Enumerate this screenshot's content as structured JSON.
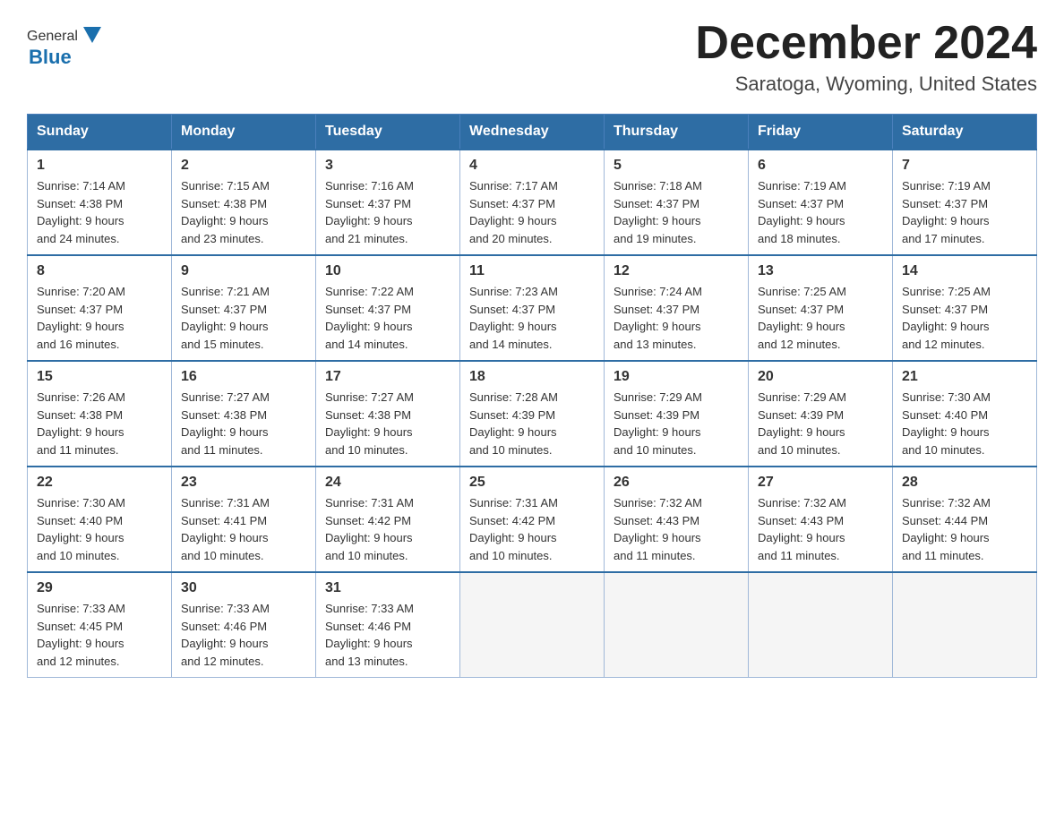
{
  "logo": {
    "general": "General",
    "blue": "Blue"
  },
  "title": "December 2024",
  "location": "Saratoga, Wyoming, United States",
  "days_of_week": [
    "Sunday",
    "Monday",
    "Tuesday",
    "Wednesday",
    "Thursday",
    "Friday",
    "Saturday"
  ],
  "weeks": [
    [
      {
        "day": "1",
        "sunrise": "7:14 AM",
        "sunset": "4:38 PM",
        "daylight": "9 hours and 24 minutes."
      },
      {
        "day": "2",
        "sunrise": "7:15 AM",
        "sunset": "4:38 PM",
        "daylight": "9 hours and 23 minutes."
      },
      {
        "day": "3",
        "sunrise": "7:16 AM",
        "sunset": "4:37 PM",
        "daylight": "9 hours and 21 minutes."
      },
      {
        "day": "4",
        "sunrise": "7:17 AM",
        "sunset": "4:37 PM",
        "daylight": "9 hours and 20 minutes."
      },
      {
        "day": "5",
        "sunrise": "7:18 AM",
        "sunset": "4:37 PM",
        "daylight": "9 hours and 19 minutes."
      },
      {
        "day": "6",
        "sunrise": "7:19 AM",
        "sunset": "4:37 PM",
        "daylight": "9 hours and 18 minutes."
      },
      {
        "day": "7",
        "sunrise": "7:19 AM",
        "sunset": "4:37 PM",
        "daylight": "9 hours and 17 minutes."
      }
    ],
    [
      {
        "day": "8",
        "sunrise": "7:20 AM",
        "sunset": "4:37 PM",
        "daylight": "9 hours and 16 minutes."
      },
      {
        "day": "9",
        "sunrise": "7:21 AM",
        "sunset": "4:37 PM",
        "daylight": "9 hours and 15 minutes."
      },
      {
        "day": "10",
        "sunrise": "7:22 AM",
        "sunset": "4:37 PM",
        "daylight": "9 hours and 14 minutes."
      },
      {
        "day": "11",
        "sunrise": "7:23 AM",
        "sunset": "4:37 PM",
        "daylight": "9 hours and 14 minutes."
      },
      {
        "day": "12",
        "sunrise": "7:24 AM",
        "sunset": "4:37 PM",
        "daylight": "9 hours and 13 minutes."
      },
      {
        "day": "13",
        "sunrise": "7:25 AM",
        "sunset": "4:37 PM",
        "daylight": "9 hours and 12 minutes."
      },
      {
        "day": "14",
        "sunrise": "7:25 AM",
        "sunset": "4:37 PM",
        "daylight": "9 hours and 12 minutes."
      }
    ],
    [
      {
        "day": "15",
        "sunrise": "7:26 AM",
        "sunset": "4:38 PM",
        "daylight": "9 hours and 11 minutes."
      },
      {
        "day": "16",
        "sunrise": "7:27 AM",
        "sunset": "4:38 PM",
        "daylight": "9 hours and 11 minutes."
      },
      {
        "day": "17",
        "sunrise": "7:27 AM",
        "sunset": "4:38 PM",
        "daylight": "9 hours and 10 minutes."
      },
      {
        "day": "18",
        "sunrise": "7:28 AM",
        "sunset": "4:39 PM",
        "daylight": "9 hours and 10 minutes."
      },
      {
        "day": "19",
        "sunrise": "7:29 AM",
        "sunset": "4:39 PM",
        "daylight": "9 hours and 10 minutes."
      },
      {
        "day": "20",
        "sunrise": "7:29 AM",
        "sunset": "4:39 PM",
        "daylight": "9 hours and 10 minutes."
      },
      {
        "day": "21",
        "sunrise": "7:30 AM",
        "sunset": "4:40 PM",
        "daylight": "9 hours and 10 minutes."
      }
    ],
    [
      {
        "day": "22",
        "sunrise": "7:30 AM",
        "sunset": "4:40 PM",
        "daylight": "9 hours and 10 minutes."
      },
      {
        "day": "23",
        "sunrise": "7:31 AM",
        "sunset": "4:41 PM",
        "daylight": "9 hours and 10 minutes."
      },
      {
        "day": "24",
        "sunrise": "7:31 AM",
        "sunset": "4:42 PM",
        "daylight": "9 hours and 10 minutes."
      },
      {
        "day": "25",
        "sunrise": "7:31 AM",
        "sunset": "4:42 PM",
        "daylight": "9 hours and 10 minutes."
      },
      {
        "day": "26",
        "sunrise": "7:32 AM",
        "sunset": "4:43 PM",
        "daylight": "9 hours and 11 minutes."
      },
      {
        "day": "27",
        "sunrise": "7:32 AM",
        "sunset": "4:43 PM",
        "daylight": "9 hours and 11 minutes."
      },
      {
        "day": "28",
        "sunrise": "7:32 AM",
        "sunset": "4:44 PM",
        "daylight": "9 hours and 11 minutes."
      }
    ],
    [
      {
        "day": "29",
        "sunrise": "7:33 AM",
        "sunset": "4:45 PM",
        "daylight": "9 hours and 12 minutes."
      },
      {
        "day": "30",
        "sunrise": "7:33 AM",
        "sunset": "4:46 PM",
        "daylight": "9 hours and 12 minutes."
      },
      {
        "day": "31",
        "sunrise": "7:33 AM",
        "sunset": "4:46 PM",
        "daylight": "9 hours and 13 minutes."
      },
      null,
      null,
      null,
      null
    ]
  ],
  "labels": {
    "sunrise": "Sunrise:",
    "sunset": "Sunset:",
    "daylight": "Daylight:"
  }
}
